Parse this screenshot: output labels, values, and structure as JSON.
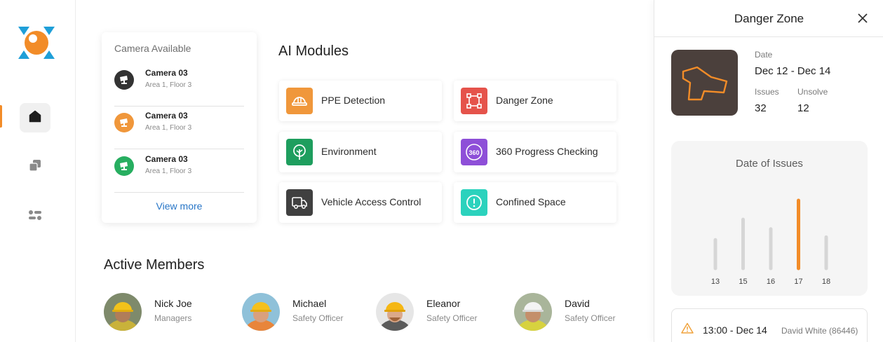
{
  "camera_card": {
    "title": "Camera Available",
    "cameras": [
      {
        "name": "Camera 03",
        "location": "Area 1, Floor 3",
        "status_color": "#333333"
      },
      {
        "name": "Camera 03",
        "location": "Area 1, Floor 3",
        "status_color": "#f0973b"
      },
      {
        "name": "Camera 03",
        "location": "Area 1, Floor 3",
        "status_color": "#27ae60"
      }
    ],
    "view_more": "View more"
  },
  "ai_modules": {
    "title": "AI Modules",
    "items": [
      {
        "label": "PPE Detection",
        "icon": "hard-hat-icon",
        "color": "#f0973b"
      },
      {
        "label": "Danger Zone",
        "icon": "zone-select-icon",
        "color": "#e5534b"
      },
      {
        "label": "Environment",
        "icon": "tree-icon",
        "color": "#1e9e5e"
      },
      {
        "label": "360 Progress Checking",
        "icon": "360-icon",
        "color": "#8e4fd8"
      },
      {
        "label": "Vehicle Access Control",
        "icon": "truck-icon",
        "color": "#404040"
      },
      {
        "label": "Confined Space",
        "icon": "alert-icon",
        "color": "#2bd2bd"
      }
    ]
  },
  "active_members": {
    "title": "Active Members",
    "members": [
      {
        "name": "Nick Joe",
        "role": "Managers"
      },
      {
        "name": "Michael",
        "role": "Safety Officer"
      },
      {
        "name": "Eleanor",
        "role": "Safety Officer"
      },
      {
        "name": "David",
        "role": "Safety Officer"
      }
    ]
  },
  "panel": {
    "title": "Danger Zone",
    "date_label": "Date",
    "date_value": "Dec 12 - Dec 14",
    "issues_label": "Issues",
    "issues_value": "32",
    "unsolve_label": "Unsolve",
    "unsolve_value": "12",
    "issue": {
      "time": "13:00 - Dec 14",
      "user": "David White (86446)"
    }
  },
  "chart_data": {
    "type": "bar",
    "title": "Date of Issues",
    "categories": [
      "13",
      "15",
      "16",
      "17",
      "18"
    ],
    "values": [
      0.42,
      0.72,
      0.58,
      1.0,
      0.46
    ],
    "highlight": "17",
    "colors": {
      "default": "#d6d6d6",
      "highlight": "#f28c28"
    }
  },
  "colors": {
    "accent": "#f28c28",
    "link": "#2876c7"
  }
}
